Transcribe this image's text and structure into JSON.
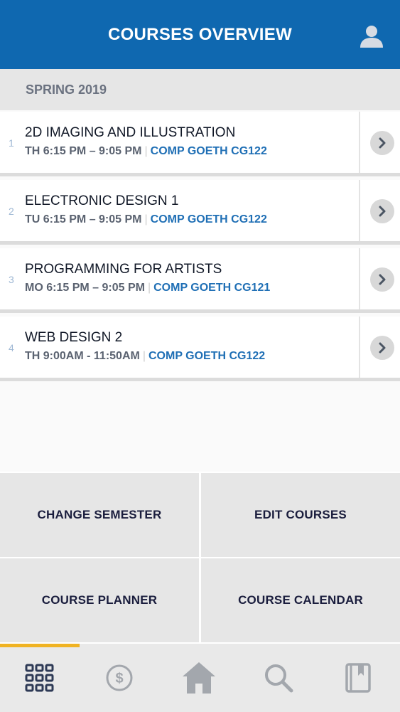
{
  "header": {
    "title": "COURSES OVERVIEW",
    "avatar_icon": "user-icon"
  },
  "semester_label": "SPRING 2019",
  "courses": [
    {
      "index": "1",
      "name": "2D IMAGING AND ILLUSTRATION",
      "time": "TH 6:15 PM – 9:05 PM",
      "room": "COMP GOETH CG122"
    },
    {
      "index": "2",
      "name": "ELECTRONIC DESIGN 1",
      "time": "TU 6:15 PM – 9:05 PM",
      "room": "COMP GOETH CG122"
    },
    {
      "index": "3",
      "name": "PROGRAMMING FOR ARTISTS",
      "time": "MO 6:15 PM – 9:05 PM",
      "room": "COMP GOETH CG121"
    },
    {
      "index": "4",
      "name": "WEB DESIGN 2",
      "time": "TH 9:00AM - 11:50AM",
      "room": "COMP GOETH CG122"
    }
  ],
  "actions": {
    "change_semester": "CHANGE SEMESTER",
    "edit_courses": "EDIT COURSES",
    "course_planner": "COURSE PLANNER",
    "course_calendar": "COURSE CALENDAR"
  },
  "tabbar": {
    "items": [
      "grid-icon",
      "dollar-icon",
      "home-icon",
      "search-icon",
      "book-icon"
    ],
    "active_index": 0,
    "active_color": "#f0b323"
  },
  "colors": {
    "header": "#0f68b0",
    "room_text": "#1f6fb5"
  }
}
